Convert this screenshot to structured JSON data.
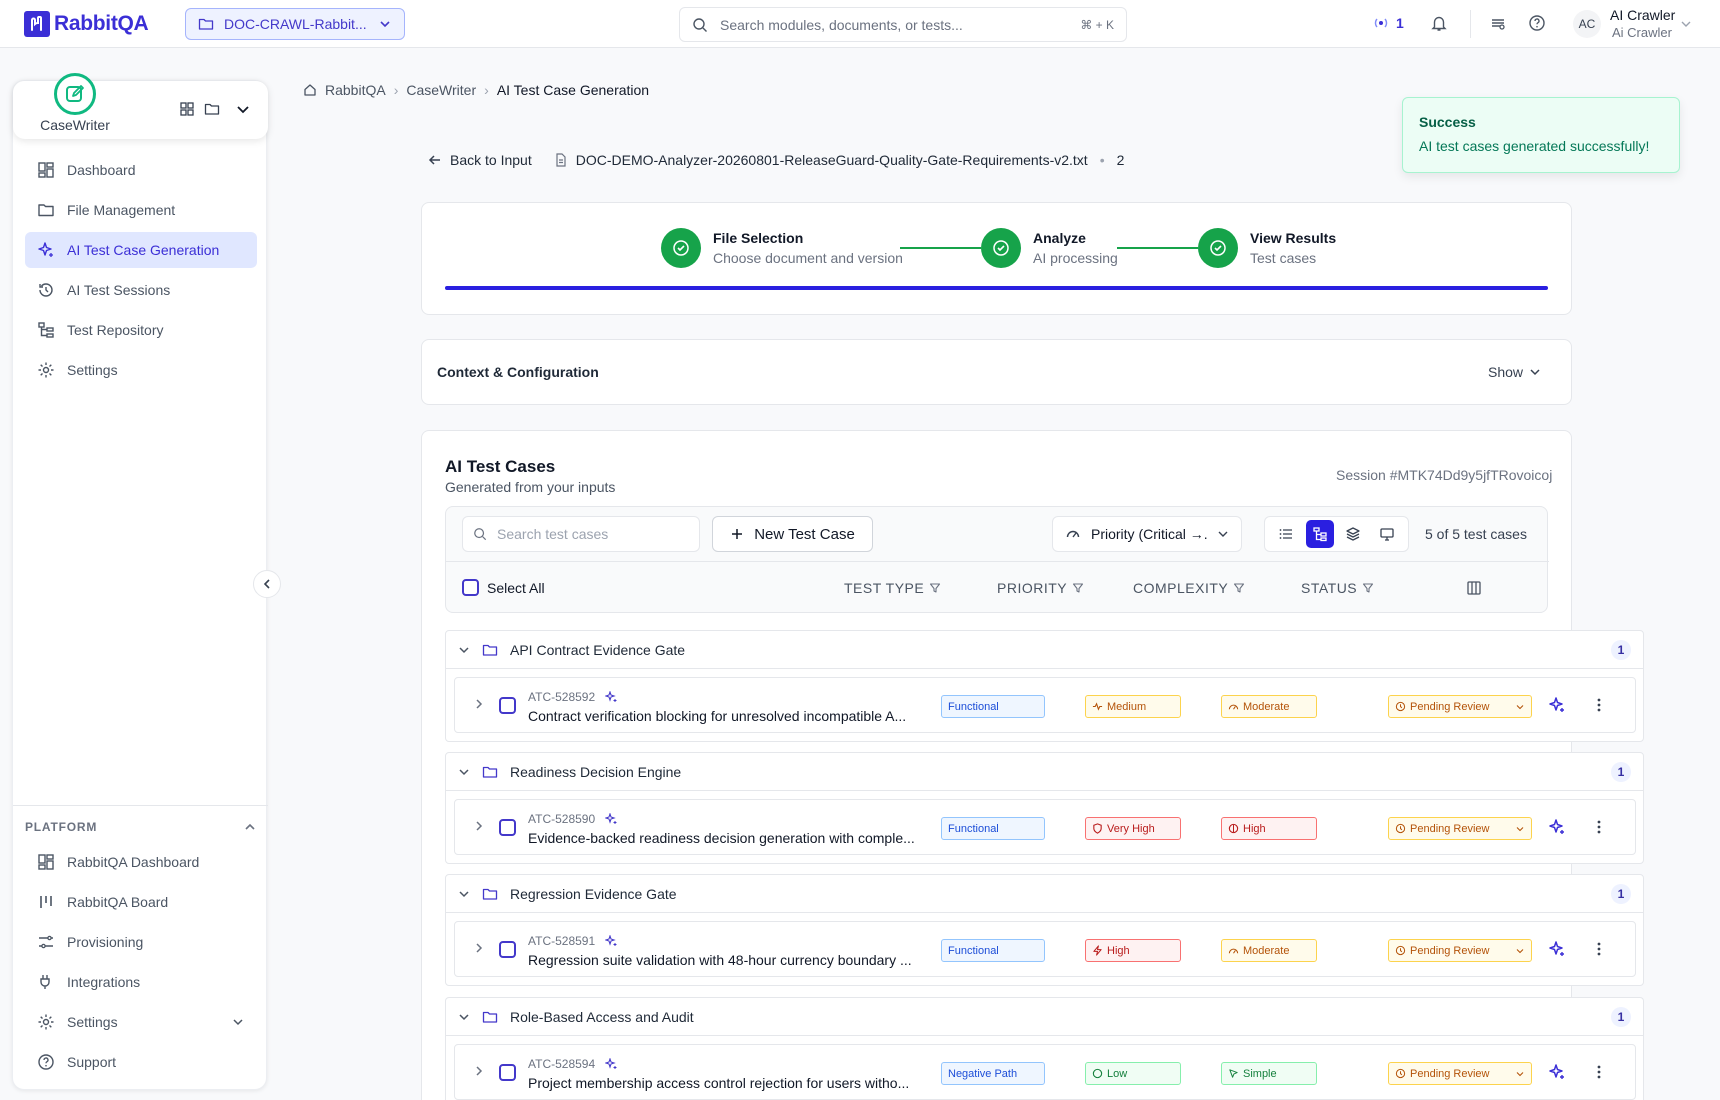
{
  "header": {
    "brand": "RabbitQA",
    "workspace": "DOC-CRAWL-Rabbit...",
    "search_placeholder": "Search modules, documents, or tests...",
    "search_shortcut": "⌘ + K",
    "live_count": "1",
    "user_initials": "AC",
    "user_name": "AI Crawler",
    "user_role": "Ai Crawler"
  },
  "sidebar": {
    "app_name": "CaseWriter",
    "items": [
      {
        "label": "Dashboard",
        "icon": "dashboard-icon"
      },
      {
        "label": "File Management",
        "icon": "folder-icon"
      },
      {
        "label": "AI Test Case Generation",
        "icon": "sparkle-icon",
        "active": true
      },
      {
        "label": "AI Test Sessions",
        "icon": "history-icon"
      },
      {
        "label": "Test Repository",
        "icon": "tree-icon"
      },
      {
        "label": "Settings",
        "icon": "gear-icon"
      }
    ],
    "platform_label": "PLATFORM",
    "platform_items": [
      {
        "label": "RabbitQA Dashboard",
        "icon": "dashboard-icon"
      },
      {
        "label": "RabbitQA Board",
        "icon": "board-icon"
      },
      {
        "label": "Provisioning",
        "icon": "sliders-icon"
      },
      {
        "label": "Integrations",
        "icon": "plug-icon"
      },
      {
        "label": "Settings",
        "icon": "gear-icon"
      },
      {
        "label": "Support",
        "icon": "help-icon"
      }
    ]
  },
  "breadcrumb": [
    "RabbitQA",
    "CaseWriter",
    "AI Test Case Generation"
  ],
  "toast": {
    "title": "Success",
    "message": "AI test cases generated successfully!"
  },
  "back_label": "Back to Input",
  "document": {
    "name": "DOC-DEMO-Analyzer-20260801-ReleaseGuard-Quality-Gate-Requirements-v2.txt",
    "version": "2"
  },
  "steps": [
    {
      "title": "File Selection",
      "subtitle": "Choose document and version"
    },
    {
      "title": "Analyze",
      "subtitle": "AI processing"
    },
    {
      "title": "View Results",
      "subtitle": "Test cases"
    }
  ],
  "progress_fraction": 1.0,
  "context": {
    "title": "Context & Configuration",
    "toggle": "Show"
  },
  "test_cases": {
    "title": "AI Test Cases",
    "subtitle": "Generated from your inputs",
    "session": "Session #MTK74Dd9y5jfTRovoicoj",
    "search_placeholder": "Search test cases",
    "new_label": "New Test Case",
    "sort_label": "Priority (Critical →...",
    "count_label": "5 of 5 test cases",
    "select_all": "Select All",
    "columns": [
      "TEST TYPE",
      "PRIORITY",
      "COMPLEXITY",
      "STATUS"
    ]
  },
  "groups": [
    {
      "name": "API Contract Evidence Gate",
      "count": "1",
      "row": {
        "id": "ATC-528592",
        "title": "Contract verification blocking for unresolved incompatible A...",
        "type": "Functional",
        "priority": "Medium",
        "complexity": "Moderate",
        "status": "Pending Review"
      }
    },
    {
      "name": "Readiness Decision Engine",
      "count": "1",
      "row": {
        "id": "ATC-528590",
        "title": "Evidence-backed readiness decision generation with comple...",
        "type": "Functional",
        "priority": "Very High",
        "complexity": "High",
        "status": "Pending Review"
      }
    },
    {
      "name": "Regression Evidence Gate",
      "count": "1",
      "row": {
        "id": "ATC-528591",
        "title": "Regression suite validation with 48-hour currency boundary ...",
        "type": "Functional",
        "priority": "High",
        "complexity": "Moderate",
        "status": "Pending Review"
      }
    },
    {
      "name": "Role-Based Access and Audit",
      "count": "1",
      "row": {
        "id": "ATC-528594",
        "title": "Project membership access control rejection for users witho...",
        "type": "Negative Path",
        "priority": "Low",
        "complexity": "Simple",
        "status": "Pending Review"
      }
    }
  ],
  "colors": {
    "brand": "#3b2fd6",
    "success": "#16a34a",
    "active_bg": "#e0e7ff"
  }
}
